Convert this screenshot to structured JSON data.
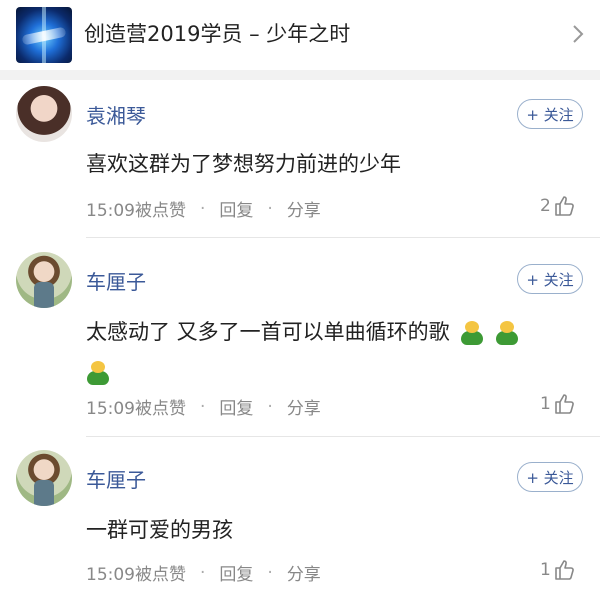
{
  "header": {
    "title": "创造营2019学员 – 少年之时",
    "thumb_icon": "show-poster-thumbnail",
    "chevron_icon": "chevron-right-icon"
  },
  "comments": [
    {
      "name": "袁湘琴",
      "follow_label": "+ 关注",
      "text": "喜欢这群为了梦想努力前进的少年",
      "time_liked": "15:09被点赞",
      "reply_label": "回复",
      "share_label": "分享",
      "likes": "2",
      "emojis": 0
    },
    {
      "name": "车厘子",
      "follow_label": "+ 关注",
      "text": "太感动了 又多了一首可以单曲循环的歌",
      "time_liked": "15:09被点赞",
      "reply_label": "回复",
      "share_label": "分享",
      "likes": "1",
      "emojis": 3
    },
    {
      "name": "车厘子",
      "follow_label": "+ 关注",
      "text": "一群可爱的男孩",
      "time_liked": "15:09被点赞",
      "reply_label": "回复",
      "share_label": "分享",
      "likes": "1",
      "emojis": 0
    }
  ],
  "icons": {
    "like": "thumbs-up-icon",
    "emoji": "frog-emoji-icon"
  },
  "colors": {
    "name": "#3b5998",
    "meta": "#888888",
    "follow_border": "#9ab0cc",
    "divider": "#f2f2f2"
  }
}
